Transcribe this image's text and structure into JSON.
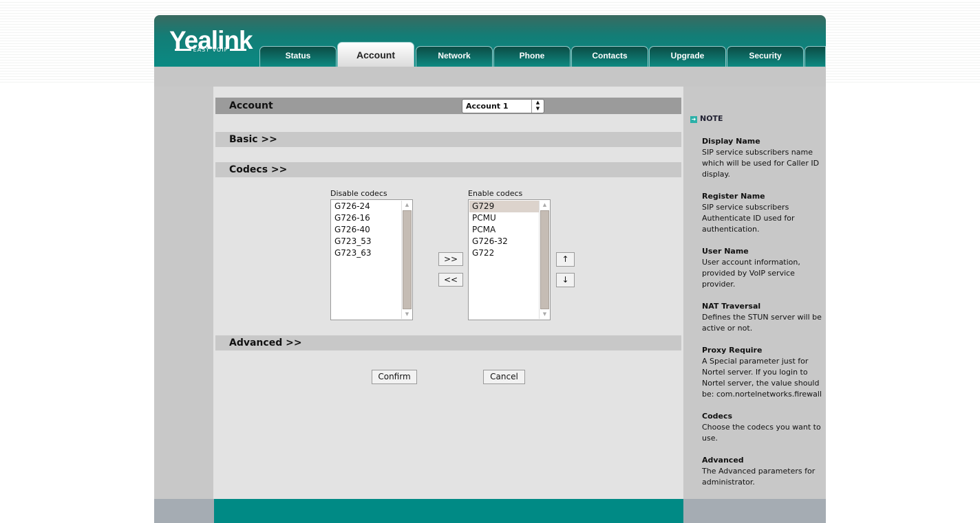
{
  "logo": {
    "text": "Yealink",
    "tagline": "EASY VOIP"
  },
  "tabs": [
    {
      "label": "Status"
    },
    {
      "label": "Account",
      "active": true
    },
    {
      "label": "Network"
    },
    {
      "label": "Phone"
    },
    {
      "label": "Contacts"
    },
    {
      "label": "Upgrade"
    },
    {
      "label": "Security"
    }
  ],
  "account": {
    "title": "Account",
    "selected": "Account 1"
  },
  "sections": {
    "basic": "Basic >>",
    "codecs": "Codecs >>",
    "advanced": "Advanced >>"
  },
  "codecs": {
    "disable_label": "Disable codecs",
    "enable_label": "Enable codecs",
    "disabled": [
      "G726-24",
      "G726-16",
      "G726-40",
      "G723_53",
      "G723_63"
    ],
    "enabled": [
      "G729",
      "PCMU",
      "PCMA",
      "G726-32",
      "G722"
    ],
    "selected_enabled": "G729",
    "add": ">>",
    "remove": "<<",
    "up": "↑",
    "down": "↓"
  },
  "buttons": {
    "confirm": "Confirm",
    "cancel": "Cancel"
  },
  "note": {
    "title": "NOTE",
    "items": [
      {
        "title": "Display Name",
        "text": "SIP service subscribers name which will be used for Caller ID display."
      },
      {
        "title": "Register Name",
        "text": "SIP service subscribers Authenticate ID used for authentication."
      },
      {
        "title": "User Name",
        "text": "User account information, provided by VoIP service provider."
      },
      {
        "title": "NAT Traversal",
        "text": "Defines the STUN server will be active or not."
      },
      {
        "title": "Proxy Require",
        "text": "A Special parameter just for Nortel server. If you login to Nortel server, the value should be: com.nortelnetworks.firewall"
      },
      {
        "title": "Codecs",
        "text": "Choose the codecs you want to use."
      },
      {
        "title": "Advanced",
        "text": "The Advanced parameters for administrator."
      }
    ]
  },
  "colors": {
    "brand": "#0a8a83",
    "footer": "#008a85"
  }
}
